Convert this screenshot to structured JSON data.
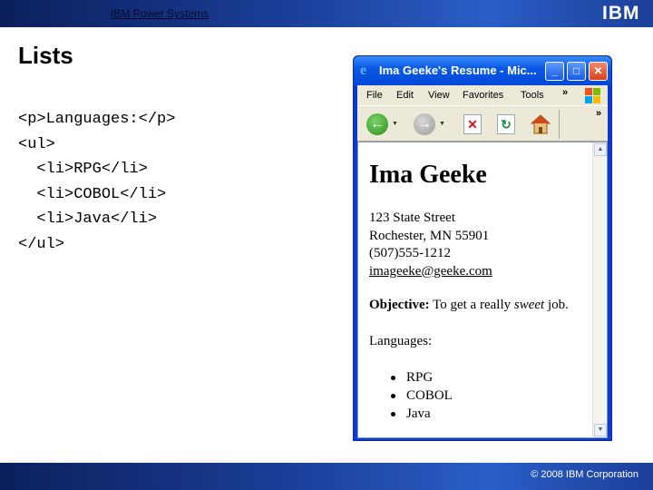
{
  "header": {
    "brand": "IBM Power Systems",
    "logo": "IBM"
  },
  "slide": {
    "title": "Lists",
    "code_lines": [
      "<p>Languages:</p>",
      "<ul>",
      "  <li>RPG</li>",
      "  <li>COBOL</li>",
      "  <li>Java</li>",
      "</ul>"
    ]
  },
  "browser": {
    "window_title": "Ima Geeke's Resume - Mic...",
    "menu": [
      "File",
      "Edit",
      "View",
      "Favorites",
      "Tools"
    ],
    "chevron": "»",
    "page": {
      "heading": "Ima Geeke",
      "address": [
        "123 State Street",
        "Rochester, MN 55901",
        "(507)555-1212"
      ],
      "email": "imageeke@geeke.com",
      "objective_label": "Objective:",
      "objective_pre": " To get a really ",
      "objective_em": "sweet",
      "objective_post": " job.",
      "languages_label": "Languages:",
      "languages": [
        "RPG",
        "COBOL",
        "Java"
      ]
    }
  },
  "footer": {
    "copyright": "© 2008 IBM Corporation"
  },
  "colors": {
    "banner_dark": "#0b1f5c",
    "banner_light": "#2a5ec6",
    "xp_blue": "#0a5ae6",
    "xp_chrome": "#ece9d8"
  }
}
